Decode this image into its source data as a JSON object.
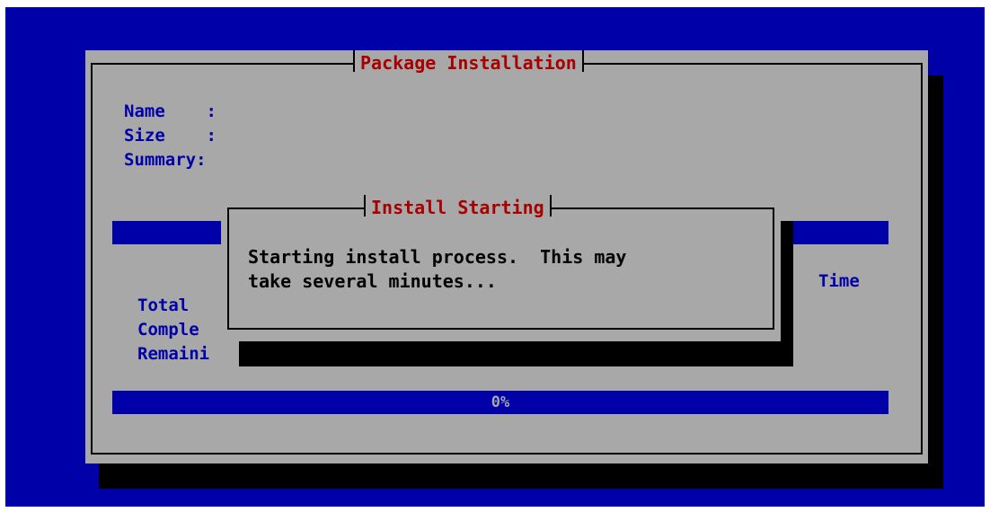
{
  "main_window": {
    "title": "Package Installation",
    "fields": {
      "name_label": "Name    :",
      "size_label": "Size    :",
      "summary_label": "Summary:"
    },
    "stats": {
      "total_label": "Total",
      "completed_label": "Comple",
      "remaining_label": "Remaini",
      "time_header": "Time"
    },
    "progress": {
      "label": "0%",
      "value": 0
    }
  },
  "dialog": {
    "title": "Install Starting",
    "message_line1": "Starting install process.  This may",
    "message_line2": "take several minutes..."
  },
  "colors": {
    "background": "#0000a8",
    "panel": "#a8a8a8",
    "title_text": "#a80000",
    "label_text": "#0000a8",
    "shadow": "#000000"
  }
}
